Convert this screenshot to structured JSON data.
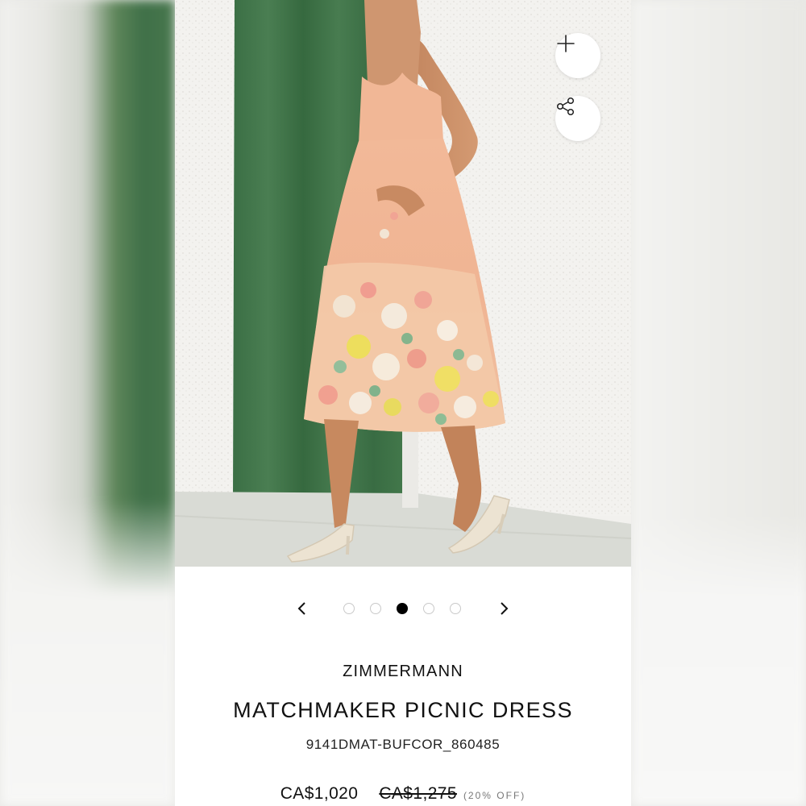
{
  "product": {
    "brand": "ZIMMERMANN",
    "name": "MATCHMAKER PICNIC DRESS",
    "sku": "9141DMAT-BUFCOR_860485",
    "price_current": "CA$1,020",
    "price_original": "CA$1,275",
    "discount": "(20% OFF)"
  },
  "gallery": {
    "image_count": 5,
    "active_index": 2
  },
  "icons": {
    "zoom": "plus-icon",
    "share": "share-icon",
    "prev": "chevron-left-icon",
    "next": "chevron-right-icon"
  },
  "colors": {
    "dress": "#f1b996",
    "curtain": "#3f7548",
    "wall": "#f3f2ef",
    "active_dot": "#000000"
  }
}
